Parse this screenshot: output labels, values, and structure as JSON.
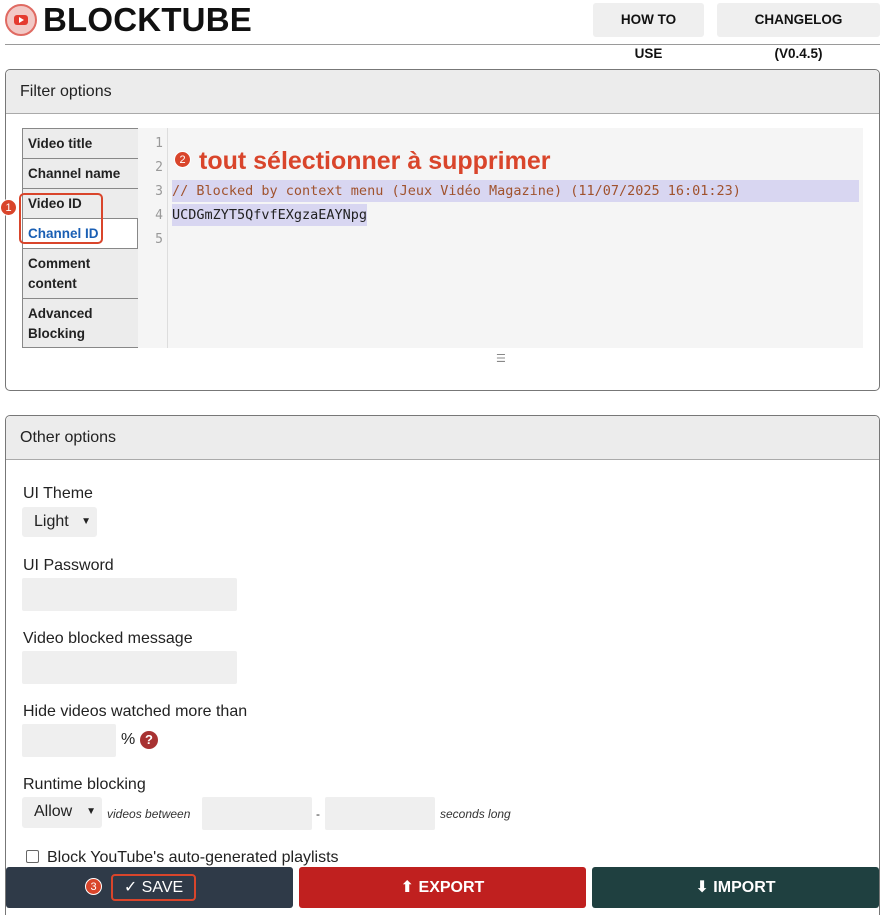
{
  "header": {
    "brand": "BLOCKTUBE",
    "how_to_use": "HOW TO USE",
    "changelog": "CHANGELOG (V0.4.5)"
  },
  "filter_panel": {
    "title": "Filter options",
    "tabs": [
      {
        "label": "Video title"
      },
      {
        "label": "Channel name"
      },
      {
        "label": "Video ID"
      },
      {
        "label": "Channel ID"
      },
      {
        "label": "Comment content"
      },
      {
        "label": "Advanced Blocking"
      }
    ],
    "editor": {
      "line_numbers": [
        "1",
        "2",
        "3",
        "4",
        "5"
      ],
      "line3": "// Blocked by context menu (Jeux Vidéo Magazine) (11/07/2025 16:01:23)",
      "line4": "UCDGmZYT5QfvfEXgzaEAYNpg"
    },
    "grip": "☰"
  },
  "annotations": {
    "one": "1",
    "two": "2",
    "three": "3",
    "note": "tout sélectionner à supprimer"
  },
  "other_panel": {
    "title": "Other options",
    "ui_theme_label": "UI Theme",
    "ui_theme_value": "Light",
    "ui_password_label": "UI Password",
    "video_blocked_label": "Video blocked message",
    "hide_watched_label": "Hide videos watched more than",
    "percent": "%",
    "help": "?",
    "runtime_label": "Runtime blocking",
    "runtime_value": "Allow",
    "videos_between": "videos between",
    "dash": "-",
    "seconds_long": "seconds long",
    "autogen_label": "Block YouTube's auto-generated playlists"
  },
  "footer": {
    "save": "✓ SAVE",
    "export": "⬆ EXPORT",
    "import": "⬇ IMPORT"
  },
  "colors": {
    "annotation": "#d9452b",
    "save_bg": "#2f3a48",
    "export_bg": "#c0201f",
    "import_bg": "#1f4040",
    "active_tab": "#1a5fb4"
  }
}
